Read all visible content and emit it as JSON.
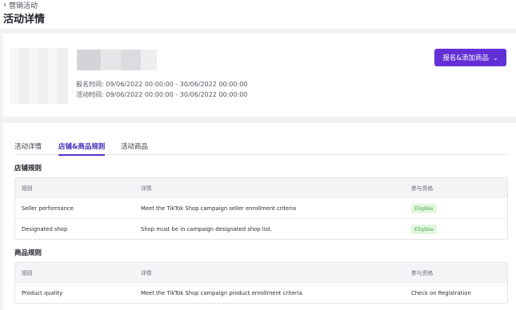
{
  "breadcrumb": {
    "back_label": "营销活动"
  },
  "page_title": "活动详情",
  "campaign": {
    "registration_time": "报名时间: 09/06/2022 00:00:00 - 30/06/2022 00:00:00",
    "activity_time": "活动时间: 09/06/2022 00:00:00 - 30/06/2022 00:00:00",
    "action_button": "报名&添加商品"
  },
  "tabs": [
    {
      "label": "活动详情",
      "active": false
    },
    {
      "label": "店铺&商品规则",
      "active": true
    },
    {
      "label": "活动商品",
      "active": false
    }
  ],
  "shop_rules": {
    "title": "店铺规则",
    "headers": [
      "规则",
      "详情",
      "参与资格"
    ],
    "rows": [
      {
        "rule": "Seller performance",
        "detail": "Meet the TikTok Shop campaign seller enrollment criteria",
        "eligibility": "Eligible"
      },
      {
        "rule": "Designated shop",
        "detail": "Shop must be in campaign designated shop list.",
        "eligibility": "Eligible"
      }
    ]
  },
  "product_rules": {
    "title": "商品规则",
    "headers": [
      "规则",
      "详情",
      "参与资格"
    ],
    "rows": [
      {
        "rule": "Product quality",
        "detail": "Meet the TikTok Shop campaign product enrollment criteria",
        "eligibility": "Check on Registration"
      }
    ]
  },
  "colors": {
    "accent": "#6330d6",
    "eligible_bg": "#e4f6df",
    "eligible_text": "#46a84a"
  },
  "icons": {
    "back": "chevron-left-icon",
    "dropdown": "chevron-down-icon"
  }
}
